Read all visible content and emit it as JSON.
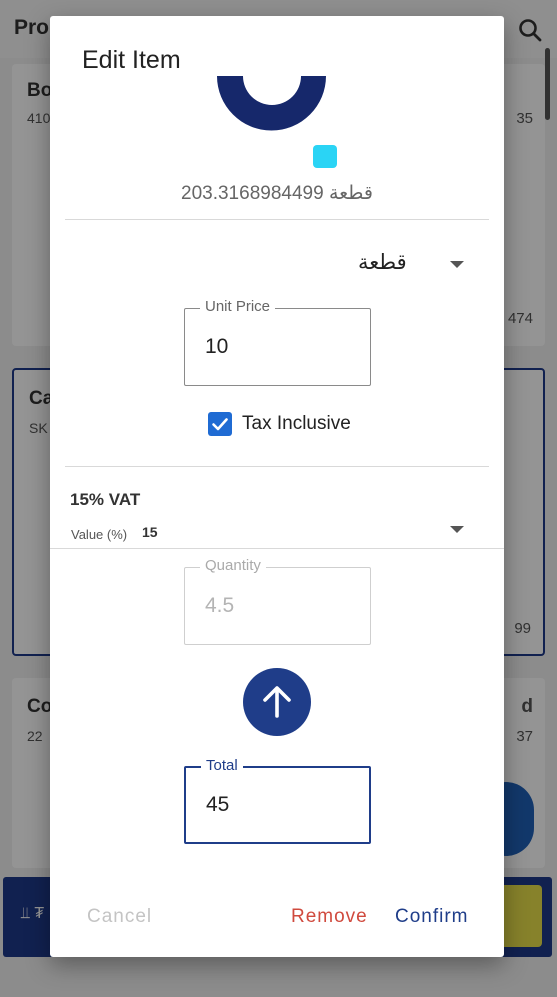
{
  "background": {
    "title": "Pro",
    "cards": [
      {
        "title": "Bo",
        "sub": "410",
        "right": "35",
        "right2": "474"
      },
      {
        "title": "Ca",
        "sub": "SK",
        "right": "99"
      },
      {
        "title": "Co",
        "sub": "22",
        "right": "d",
        "right2": "37"
      }
    ],
    "bottom_icon": "⫫ ₮"
  },
  "dialog": {
    "title": "Edit Item",
    "stock_text": "203.3168984499 قطعة",
    "unit_select": {
      "value": "قطعة"
    },
    "unit_price": {
      "label": "Unit Price",
      "value": "10"
    },
    "tax_inclusive": {
      "label": "Tax Inclusive",
      "checked": true
    },
    "tax": {
      "name": "15% VAT",
      "value_label": "Value (%)",
      "value": "15"
    },
    "quantity": {
      "label": "Quantity",
      "value": "4.5"
    },
    "total": {
      "label": "Total",
      "value": "45"
    },
    "actions": {
      "cancel": "Cancel",
      "remove": "Remove",
      "confirm": "Confirm"
    }
  },
  "colors": {
    "primary": "#1f3d89",
    "logo_accent": "#2ad4f5",
    "checkbox": "#1f6bd3",
    "remove": "#d04a3e"
  },
  "icons": [
    "search-icon",
    "brand-logo",
    "check-icon",
    "dropdown-caret-icon",
    "arrow-up-icon"
  ]
}
